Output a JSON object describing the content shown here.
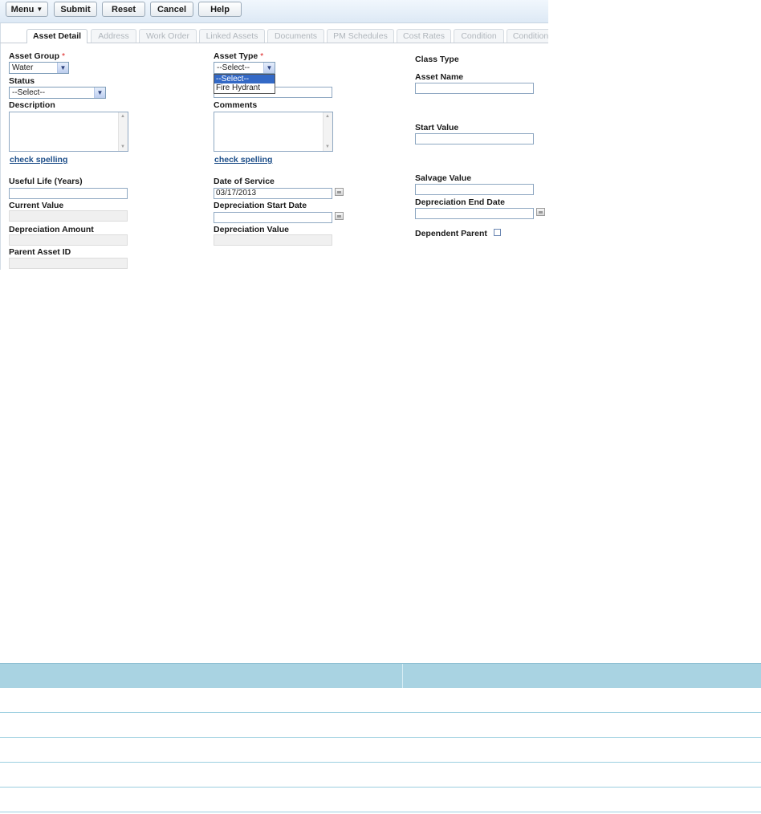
{
  "toolbar": {
    "menu_label": "Menu",
    "submit_label": "Submit",
    "reset_label": "Reset",
    "cancel_label": "Cancel",
    "help_label": "Help"
  },
  "tabs": [
    {
      "label": "Asset Detail",
      "active": true
    },
    {
      "label": "Address"
    },
    {
      "label": "Work Order"
    },
    {
      "label": "Linked Assets"
    },
    {
      "label": "Documents"
    },
    {
      "label": "PM Schedules"
    },
    {
      "label": "Cost Rates"
    },
    {
      "label": "Condition"
    },
    {
      "label": "Condition"
    }
  ],
  "form": {
    "asset_group": {
      "label": "Asset Group",
      "required_mark": "*",
      "value": "Water"
    },
    "status": {
      "label": "Status",
      "value": "--Select--"
    },
    "description": {
      "label": "Description"
    },
    "spell_link_1": "check spelling",
    "useful_life": {
      "label": "Useful Life (Years)",
      "value": ""
    },
    "current_value": {
      "label": "Current Value"
    },
    "depreciation_amount": {
      "label": "Depreciation Amount"
    },
    "parent_asset_id": {
      "label": "Parent Asset ID"
    },
    "asset_type": {
      "label": "Asset Type",
      "required_mark": "*",
      "value": "--Select--",
      "options": [
        "--Select--",
        "Fire Hydrant"
      ]
    },
    "comments": {
      "label": "Comments"
    },
    "spell_link_2": "check spelling",
    "date_of_service": {
      "label": "Date of Service",
      "value": "03/17/2013"
    },
    "depreciation_start_date": {
      "label": "Depreciation Start Date",
      "value": ""
    },
    "depreciation_value": {
      "label": "Depreciation Value"
    },
    "class_type": {
      "label": "Class Type"
    },
    "asset_name": {
      "label": "Asset Name",
      "value": ""
    },
    "start_value": {
      "label": "Start Value",
      "value": ""
    },
    "salvage_value": {
      "label": "Salvage Value",
      "value": ""
    },
    "depreciation_end_date": {
      "label": "Depreciation End Date",
      "value": ""
    },
    "dependent_parent": {
      "label": "Dependent Parent",
      "checked": false
    }
  },
  "table": {
    "columns": [
      "",
      ""
    ],
    "rows": [
      [
        "",
        ""
      ],
      [
        "",
        ""
      ],
      [
        "",
        ""
      ],
      [
        "",
        ""
      ],
      [
        "",
        ""
      ]
    ]
  },
  "colors": {
    "toolbar_bg": "#e6f0fa",
    "link": "#1d4e89",
    "required": "#dd2222",
    "dropdown_highlight": "#3369c6",
    "table_header": "#a9d3e2"
  }
}
